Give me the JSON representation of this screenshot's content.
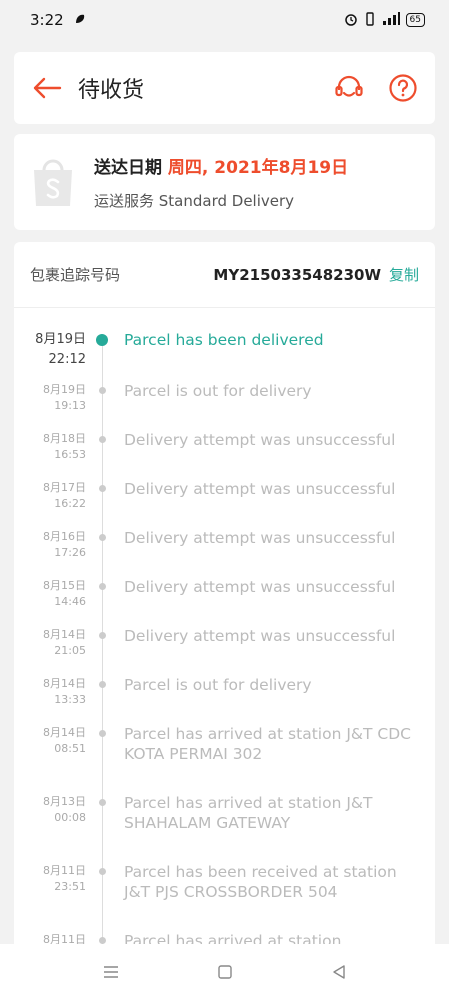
{
  "status_bar": {
    "time": "3:22",
    "battery": "65"
  },
  "header": {
    "title": "待收货"
  },
  "delivery": {
    "date_label": "送达日期",
    "date_value": "周四, 2021年8月19日",
    "service": "运送服务 Standard Delivery"
  },
  "tracking": {
    "label": "包裹追踪号码",
    "number": "MY215033548230W",
    "copy_label": "复制",
    "events": [
      {
        "date": "8月19日",
        "time": "22:12",
        "text": "Parcel has been delivered"
      },
      {
        "date": "8月19日",
        "time": "19:13",
        "text": "Parcel is out for delivery"
      },
      {
        "date": "8月18日",
        "time": "16:53",
        "text": "Delivery attempt was unsuccessful"
      },
      {
        "date": "8月17日",
        "time": "16:22",
        "text": "Delivery attempt was unsuccessful"
      },
      {
        "date": "8月16日",
        "time": "17:26",
        "text": "Delivery attempt was unsuccessful"
      },
      {
        "date": "8月15日",
        "time": "14:46",
        "text": "Delivery attempt was unsuccessful"
      },
      {
        "date": "8月14日",
        "time": "21:05",
        "text": "Delivery attempt was unsuccessful"
      },
      {
        "date": "8月14日",
        "time": "13:33",
        "text": "Parcel is out for delivery"
      },
      {
        "date": "8月14日",
        "time": "08:51",
        "text": "Parcel has arrived at station J&T CDC KOTA PERMAI 302"
      },
      {
        "date": "8月13日",
        "time": "00:08",
        "text": "Parcel has arrived at station J&T SHAHALAM GATEWAY"
      },
      {
        "date": "8月11日",
        "time": "23:51",
        "text": "Parcel has been received at station J&T PJS CROSSBORDER 504"
      },
      {
        "date": "8月11日",
        "time": "",
        "text": "Parcel has arrived at station"
      }
    ]
  },
  "colors": {
    "accent": "#ee4d2d",
    "success": "#26aa99"
  }
}
